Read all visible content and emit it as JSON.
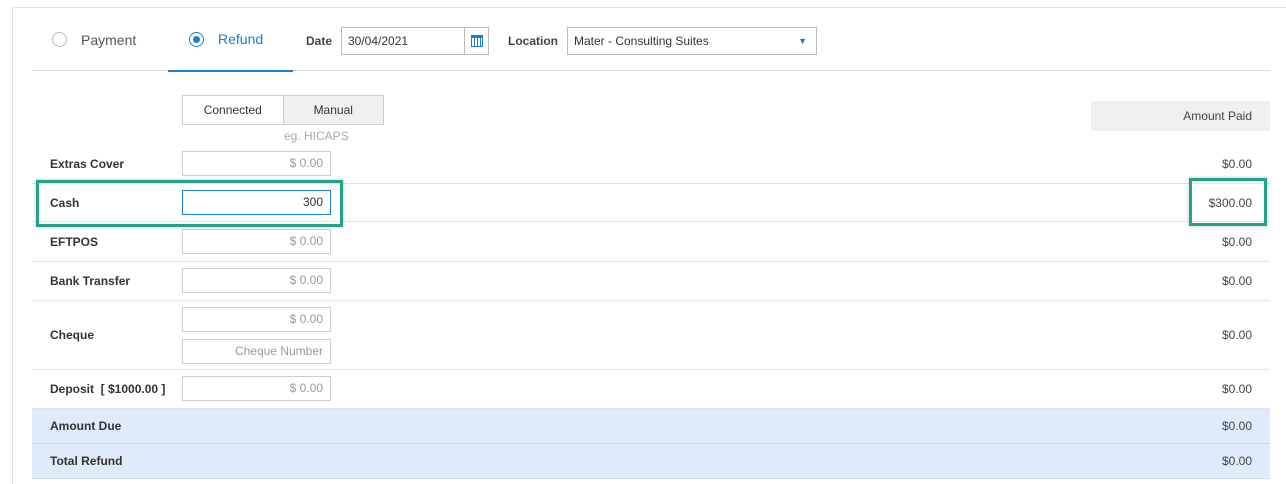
{
  "mode_tabs": [
    {
      "label": "Payment",
      "selected": false
    },
    {
      "label": "Refund",
      "selected": true
    }
  ],
  "date": {
    "label": "Date",
    "value": "30/04/2021"
  },
  "location": {
    "label": "Location",
    "value": "Mater - Consulting Suites"
  },
  "toggle": {
    "connected": "Connected",
    "manual": "Manual",
    "hint": "eg. HICAPS"
  },
  "amount_header": "Amount Paid",
  "rows": [
    {
      "label": "Extras Cover",
      "input": "$ 0.00",
      "amount": "$0.00"
    },
    {
      "label": "Cash",
      "input": "300",
      "amount": "$300.00"
    },
    {
      "label": "EFTPOS",
      "input": "$ 0.00",
      "amount": "$0.00"
    },
    {
      "label": "Bank Transfer",
      "input": "$ 0.00",
      "amount": "$0.00"
    },
    {
      "label": "Cheque",
      "input": "$ 0.00",
      "input2": "Cheque Number",
      "amount": "$0.00"
    },
    {
      "label": "Deposit  [ $1000.00 ]",
      "input": "$ 0.00",
      "amount": "$0.00"
    }
  ],
  "summary": [
    {
      "label": "Amount Due",
      "amount": "$0.00"
    },
    {
      "label": "Total Refund",
      "amount": "$0.00"
    }
  ],
  "colors": {
    "accent": "#1a7fd0",
    "highlight": "#21a38d",
    "summary_bg": "#dfeafa"
  }
}
